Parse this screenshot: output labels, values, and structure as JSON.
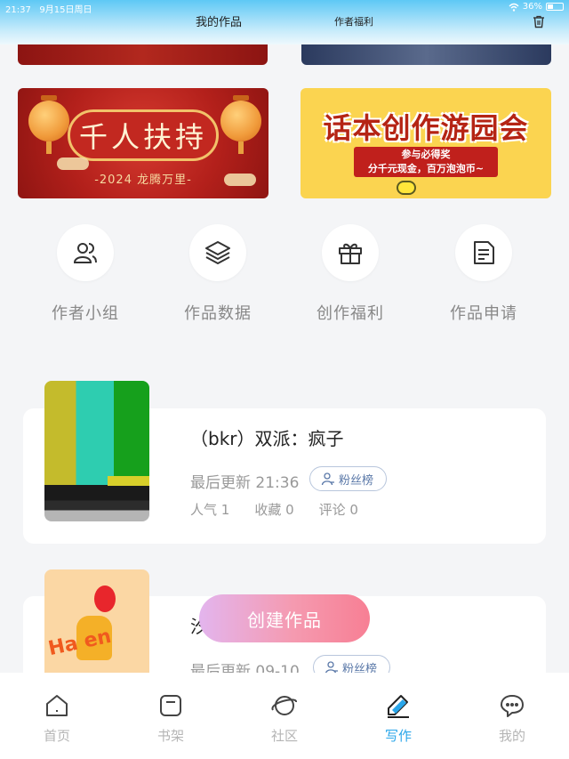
{
  "status_bar": {
    "time": "21:37",
    "date": "9月15日周日",
    "battery": "36%"
  },
  "header": {
    "tab_works": "我的作品",
    "tab_benefits": "作者福利"
  },
  "banners": {
    "left": {
      "title": "千人扶持",
      "subtitle": "-2024 龙腾万里-"
    },
    "right": {
      "title": "话本创作游园会",
      "line1": "参与必得奖",
      "line2": "分千元现金，百万泡泡币~"
    }
  },
  "shortcuts": [
    {
      "label": "作者小组",
      "icon": "people-icon"
    },
    {
      "label": "作品数据",
      "icon": "layers-icon"
    },
    {
      "label": "创作福利",
      "icon": "gift-icon"
    },
    {
      "label": "作品申请",
      "icon": "document-icon"
    }
  ],
  "works": [
    {
      "title": "（bkr）双派：疯子",
      "update": "最后更新 21:36",
      "fans_label": "粉丝榜",
      "stats": [
        "人气 1",
        "收藏 0",
        "评论 0"
      ]
    },
    {
      "title": "汐",
      "update": "最后更新 09-10",
      "fans_label": "粉丝榜",
      "cover_text": "Ha  en"
    }
  ],
  "create_button": "创建作品",
  "nav": [
    {
      "label": "首页",
      "icon": "home-icon",
      "active": false
    },
    {
      "label": "书架",
      "icon": "bookshelf-icon",
      "active": false
    },
    {
      "label": "社区",
      "icon": "planet-icon",
      "active": false
    },
    {
      "label": "写作",
      "icon": "pen-icon",
      "active": true
    },
    {
      "label": "我的",
      "icon": "chat-icon",
      "active": false
    }
  ],
  "colors": {
    "accent": "#29a6ea",
    "create_start": "#e3b5ee",
    "create_end": "#f77f94"
  }
}
